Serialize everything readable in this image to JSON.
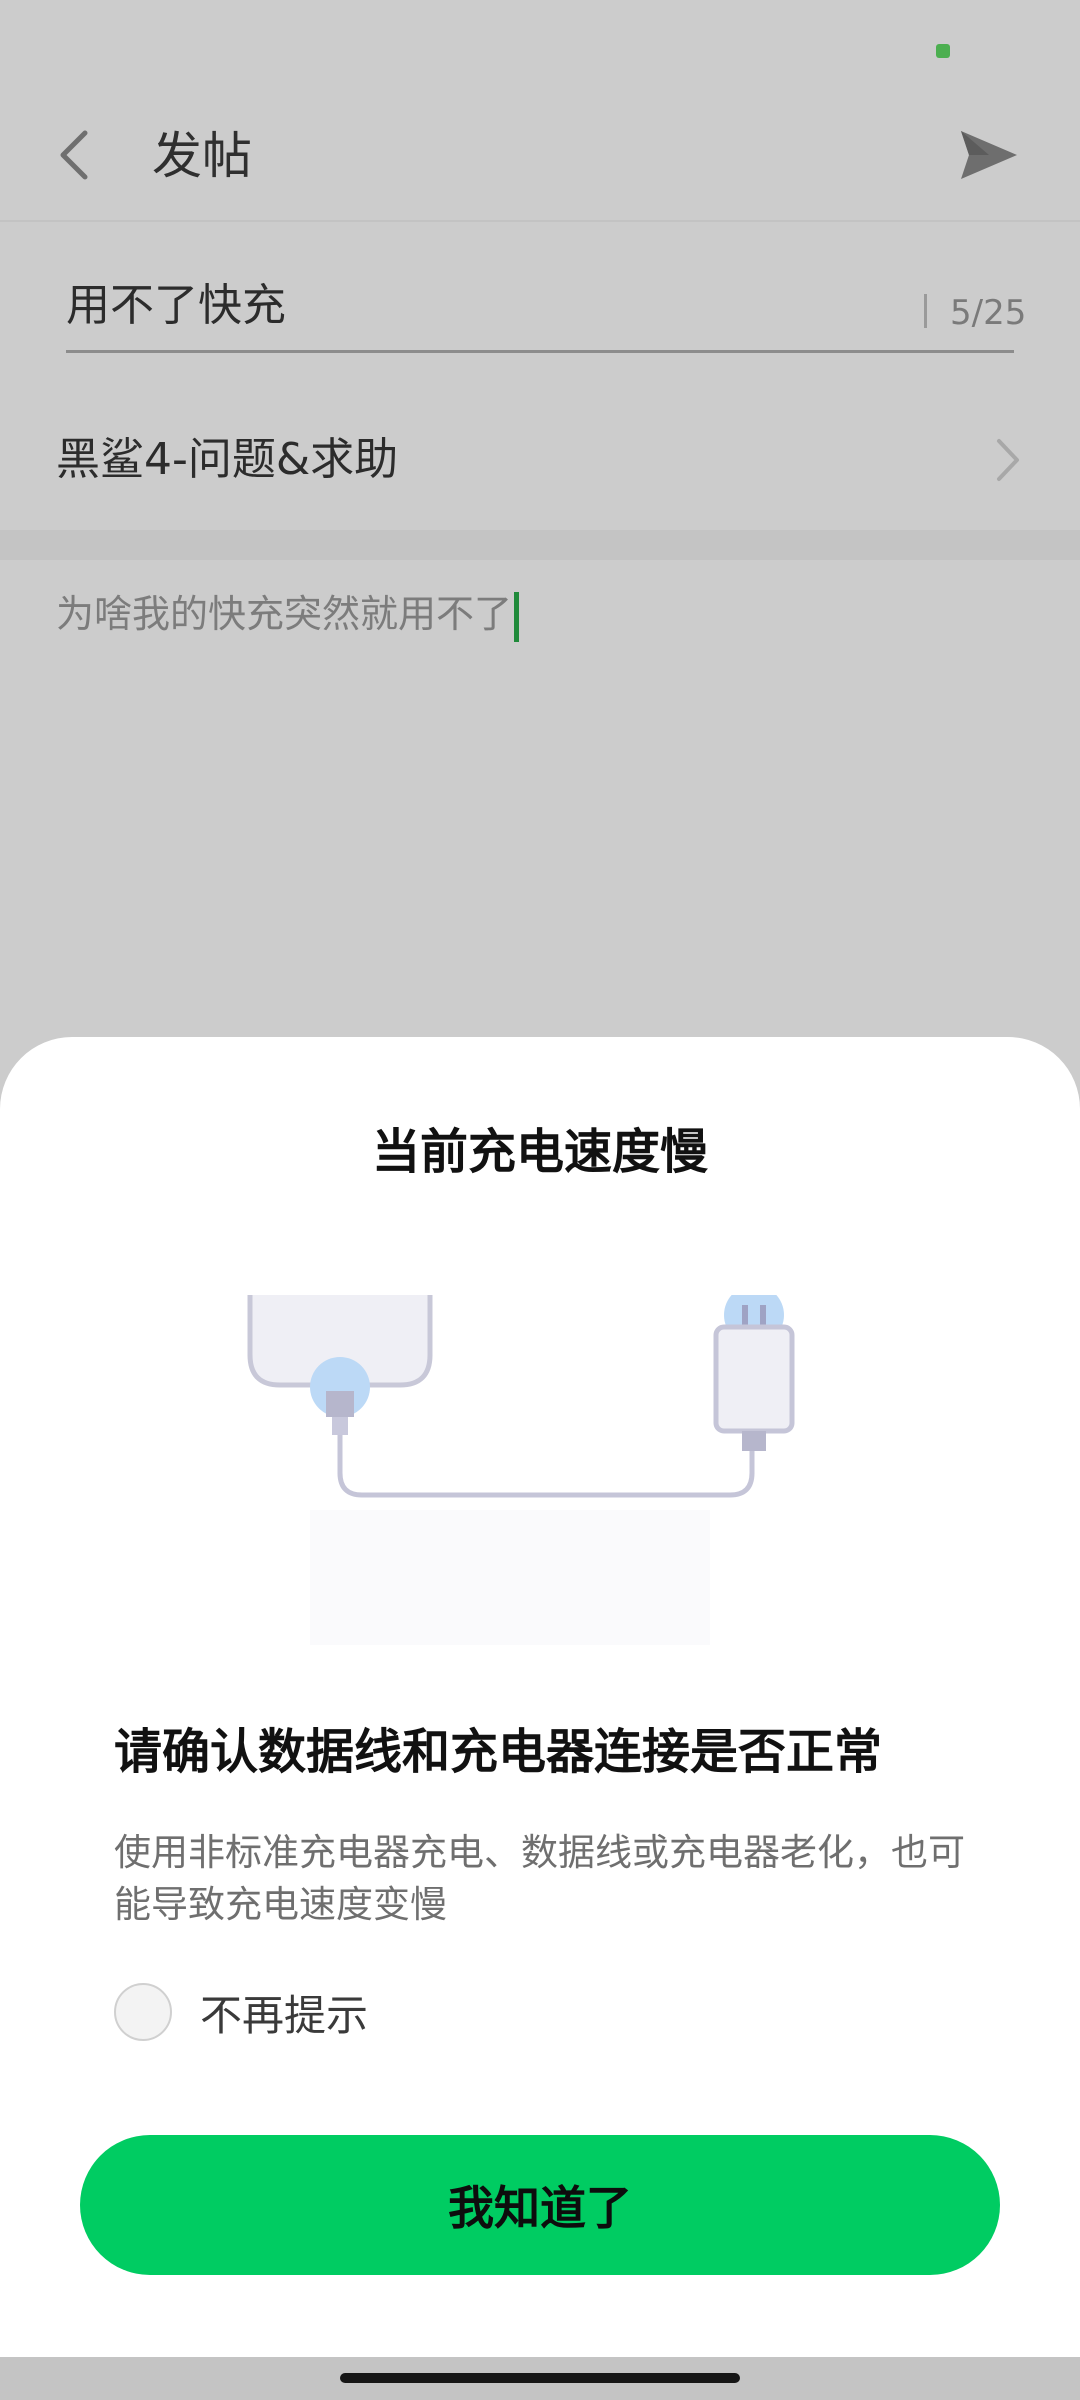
{
  "app_header": {
    "title": "发帖",
    "back_icon": "chevron-left-icon",
    "send_icon": "send-icon"
  },
  "post_form": {
    "title_value": "用不了快充",
    "title_char_count": "5/25",
    "category": "黑鲨4-问题&求助",
    "body_text": "为啥我的快充突然就用不了"
  },
  "dialog": {
    "title": "当前充电速度慢",
    "heading": "请确认数据线和充电器连接是否正常",
    "description": "使用非标准充电器充电、数据线或充电器老化，也可能导致充电速度变慢",
    "checkbox_label": "不再提示",
    "checkbox_checked": false,
    "confirm_label": "我知道了"
  },
  "colors": {
    "accent": "#00cc62",
    "caret": "#1f8a3a",
    "scrim_background": "#cccccc"
  }
}
